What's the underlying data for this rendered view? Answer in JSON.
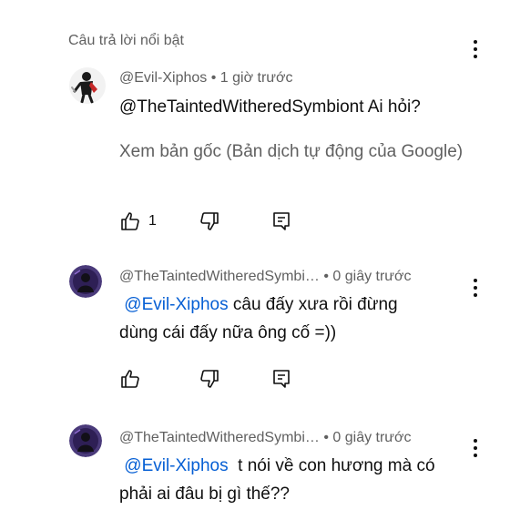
{
  "section_title": "Câu trả lời nổi bật",
  "comments": [
    {
      "author": "@Evil-Xiphos",
      "separator": " • ",
      "time": "1 giờ trước",
      "mention": "",
      "text": "@TheTaintedWitheredSymbiont Ai hỏi?",
      "translate_link": "Xem bản gốc (Bản dịch tự động của Google)",
      "likes": "1"
    },
    {
      "author": "@TheTaintedWitheredSymbi…",
      "separator": " • ",
      "time": "0 giây trước",
      "mention": "@Evil-Xiphos",
      "text_line1": " câu đấy xưa rồi đừng",
      "text_line2": "dùng cái đấy nữa ông cố =))",
      "likes": ""
    },
    {
      "author": "@TheTaintedWitheredSymbi…",
      "separator": " • ",
      "time": "0 giây trước",
      "mention": "@Evil-Xiphos",
      "text_line1": "  t nói về con hương mà có",
      "text_line2": "phải ai đâu bị gì thế??"
    }
  ],
  "icons": {
    "like": "thumb-up-outline",
    "dislike": "thumb-down-outline",
    "reply": "comment-reply",
    "menu": "more-vert"
  },
  "colors": {
    "mention": "#065fd4",
    "secondary": "#606060",
    "primary": "#0f0f0f"
  }
}
